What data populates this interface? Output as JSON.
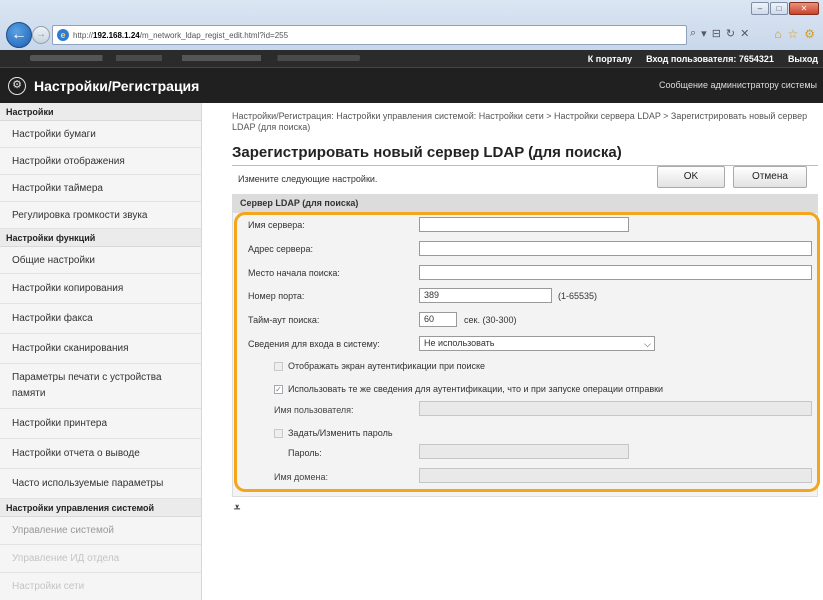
{
  "browser": {
    "url_prefix": "http://",
    "url_host": "192.168.1.24",
    "url_path": "/m_network_ldap_regist_edit.html?id=255"
  },
  "topbar": {
    "portal_link": "К порталу",
    "login_info": "Вход пользователя: 7654321",
    "logout_link": "Выход"
  },
  "header": {
    "title": "Настройки/Регистрация",
    "admin_message": "Сообщение администратору системы"
  },
  "sidebar": {
    "groups": [
      {
        "heading": "Настройки",
        "items": [
          "Настройки бумаги",
          "Настройки отображения",
          "Настройки таймера",
          "Регулировка громкости звука"
        ]
      },
      {
        "heading": "Настройки функций",
        "items": [
          "Общие настройки",
          "Настройки копирования",
          "Настройки факса",
          "Настройки сканирования",
          "Параметры печати с устройства памяти",
          "Настройки принтера",
          "Настройки отчета о выводе",
          "Часто используемые параметры"
        ]
      },
      {
        "heading": "Настройки управления системой",
        "items": [
          "Управление системой",
          "Управление ИД отдела",
          "Настройки сети"
        ]
      }
    ]
  },
  "main": {
    "breadcrumb": "Настройки/Регистрация: Настройки управления системой: Настройки сети > Настройки сервера LDAP > Зарегистрировать новый сервер LDAP (для поиска)",
    "page_title": "Зарегистрировать новый сервер LDAP (для поиска)",
    "instruction": "Измените следующие настройки.",
    "ok_label": "OK",
    "cancel_label": "Отмена",
    "section_title": "Сервер LDAP (для поиска)",
    "form": {
      "server_name_label": "Имя сервера:",
      "server_name_value": "",
      "server_address_label": "Адрес сервера:",
      "server_address_value": "",
      "search_root_label": "Место начала поиска:",
      "search_root_value": "",
      "port_label": "Номер порта:",
      "port_value": "389",
      "port_range": "(1-65535)",
      "timeout_label": "Тайм-аут поиска:",
      "timeout_value": "60",
      "timeout_units": "сек. (30-300)",
      "login_info_label": "Сведения для входа в систему:",
      "login_info_value": "Не использовать",
      "show_auth_screen_label": "Отображать экран аутентификации при поиске",
      "show_auth_screen_checked": false,
      "use_same_info_label": "Использовать те же сведения для аутентификации, что и при запуске операции отправки",
      "use_same_info_checked": true,
      "username_label": "Имя пользователя:",
      "username_value": "",
      "set_password_label": "Задать/Изменить пароль",
      "set_password_checked": false,
      "password_label": "Пароль:",
      "password_value": "",
      "domain_label": "Имя домена:",
      "domain_value": ""
    }
  },
  "colors": {
    "highlight": "#f2a51d",
    "header_bg": "#202020"
  }
}
